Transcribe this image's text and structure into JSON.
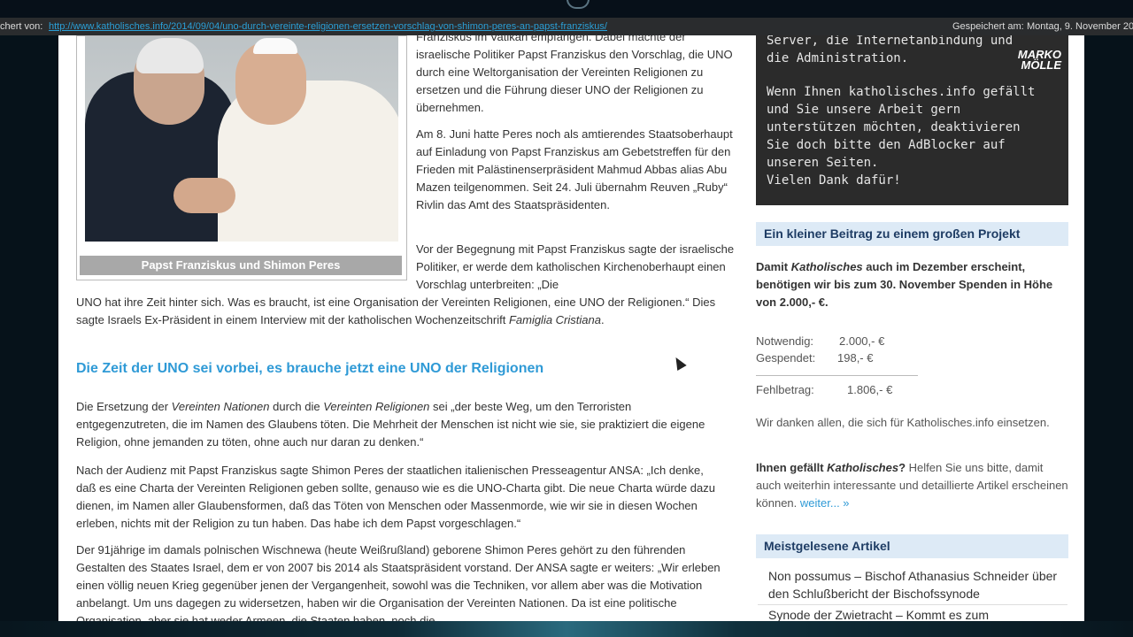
{
  "archive_bar": {
    "label": "chert von:",
    "url": "http://www.katholisches.info/2014/09/04/uno-durch-vereinte-religionen-ersetzen-vorschlag-von-shimon-peres-an-papst-franziskus/",
    "saved_label": "Gespeichert am:",
    "saved_date": "Montag, 9. November 201"
  },
  "figure": {
    "caption": "Papst Franziskus und Shimon Peres"
  },
  "article": {
    "p1": "Franziskus im Vatikan empfangen. Dabei machte der israelische Politiker Papst Franziskus den Vorschlag, die UNO durch eine Weltorganisation der Vereinten Religionen zu ersetzen und die Führung dieser UNO der Religionen zu übernehmen.",
    "p2": "Am 8. Juni hatte Peres noch als amtierendes Staatsoberhaupt auf Einladung von Papst Franziskus am Gebetstreffen für den Frieden mit Palästinenserpräsident Mahmud Abbas alias Abu Mazen teilgenommen. Seit 24. Juli übernahm Reuven „Ruby“ Rivlin das Amt des Staatspräsidenten.",
    "p3_top": "Vor der Begegnung mit Papst Franziskus sagte der israelische Politiker, er werde dem katholischen Kirchenoberhaupt einen Vorschlag unterbreiten: „Die",
    "p3_bottom": "UNO hat ihre Zeit hinter sich. Was es braucht, ist eine Organisation der Vereinten Religionen, eine UNO der Religionen.“ Dies sagte Israels Ex-Präsident in einem Interview mit der katholischen Wochenzeitschrift",
    "p3_italic": "Famiglia Cristiana",
    "p3_end": ".",
    "subheading": "Die Zeit der UNO sei vorbei, es brauche jetzt eine UNO der Religionen",
    "p4_a": "Die Ersetzung der ",
    "p4_i1": "Vereinten Nationen",
    "p4_b": " durch die ",
    "p4_i2": "Vereinten Religionen",
    "p4_c": " sei „der beste Weg, um den Terroristen entgegenzutreten, die im Namen des Glaubens töten. Die Mehrheit der Menschen ist nicht wie sie, sie praktiziert die eigene Religion, ohne jemanden zu töten, ohne auch nur daran zu denken.“",
    "p5": "Nach der Audienz mit Papst Franziskus sagte Shimon Peres der staatlichen italienischen Presseagentur ANSA: „Ich denke, daß es eine Charta der Vereinten Religionen geben sollte, genauso wie es die UNO-Charta gibt. Die neue Charta würde dazu dienen, im Namen aller Glaubensformen, daß das Töten von Menschen oder Massenmorde, wie wir sie in diesen Wochen erleben, nichts mit der Religion zu tun haben. Das habe ich dem Papst vorgeschlagen.“",
    "p6": "Der 91jährige im damals polnischen Wischnewa (heute Weißrußland) geborene Shimon Peres gehört zu den führenden Gestalten des Staates Israel, dem er von 2007 bis 2014 als Staatspräsident vorstand. Der ANSA sagte er weiters: „Wir erleben einen völlig neuen Krieg gegenüber jenen der Vergangenheit, sowohl was die Techniken, vor allem aber was die Motivation anbelangt. Um uns dagegen zu widersetzen, haben wir die Organisation der Vereinten Nationen. Da ist eine politische Organisation, aber sie hat weder Armeen, die Staaten haben, noch die"
  },
  "sidebar": {
    "dark_p1": "Server, die Internetanbindung und die Administration.",
    "dark_p2": "Wenn Ihnen katholisches.info gefällt und Sie unsere Arbeit gern unterstützen möchten, deaktivieren Sie doch bitte den AdBlocker auf unseren Seiten.",
    "dark_p3": "Vielen Dank dafür!",
    "logo_line1": "MARKO",
    "logo_line2": "MÖLLE",
    "donation_heading": "Ein kleiner Beitrag zu einem großen Projekt",
    "donation_a": "Damit ",
    "donation_italic": "Katholisches",
    "donation_b": " auch im Dezember erscheint, benötigen wir bis zum 30. November Spenden in Höhe",
    "donation_amount": "von 2.000,- €.",
    "needed_label": "Notwendig:",
    "needed_value": "2.000,- €",
    "donated_label": "Gespendet:",
    "donated_value": "198,- €",
    "missing_label": "Fehlbetrag:",
    "missing_value": "1.806,- €",
    "thanks": "Wir danken allen, die sich für Katholisches.info einsetzen.",
    "help_a": "Ihnen gefällt ",
    "help_italic": "Katholisches",
    "help_b": "?",
    "help_c": " Helfen Sie uns bitte, damit auch weiterhin interessante und detaillierte Artikel erscheinen können.",
    "more_link": "weiter... »",
    "popular_heading": "Meistgelesene Artikel",
    "popular_items": [
      "Non possumus – Bischof Athanasius Schneider über den Schlußbericht der Bischofssynode",
      "Synode der Zwietracht – Kommt es zum"
    ]
  },
  "colors": {
    "link_blue": "#2f9ad6",
    "heading_bg": "#ddeaf6",
    "dark_box": "#2b2b2b"
  }
}
